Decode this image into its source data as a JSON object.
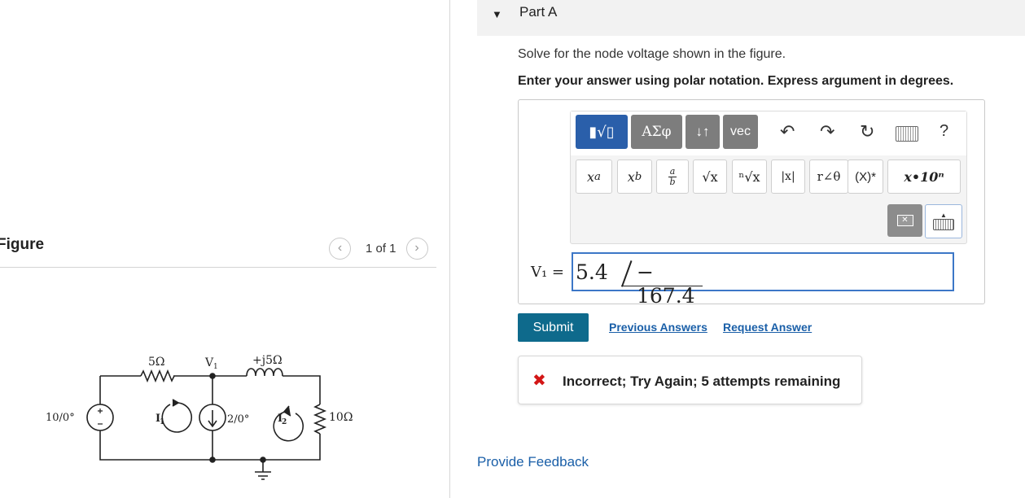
{
  "figure": {
    "title": "Figure",
    "pager_count": "1 of 1",
    "circuit": {
      "source_v": "10/0°",
      "source_i": "2/0°",
      "r1": "5Ω",
      "l1": "+j5Ω",
      "r2": "10Ω",
      "node_v": "V",
      "node_v_sub": "1",
      "mesh1_letter": "I",
      "mesh1_sub": "1",
      "mesh2_letter": "I",
      "mesh2_sub": "2"
    }
  },
  "part": {
    "title": "Part A",
    "question": "Solve for the node voltage shown in the figure.",
    "instruction": "Enter your answer using polar notation. Express argument in degrees."
  },
  "toolbar": {
    "math_label": "▮√▯",
    "greek_label": "ΑΣφ",
    "arrows_label": "↓↑",
    "vec_label": "vec",
    "undo_glyph": "↶",
    "redo_glyph": "↷",
    "reset_glyph": "↻",
    "help_glyph": "?",
    "templates": {
      "superscript_base": "x",
      "superscript_exp": "a",
      "subscript_base": "x",
      "subscript_sub": "b",
      "fraction_num": "a",
      "fraction_den": "b",
      "sqrt": "√x",
      "nth_root": "ⁿ√x",
      "abs": "|x|",
      "polar": "r∠θ",
      "conjugate": "(X)*",
      "sci": "x•10ⁿ"
    }
  },
  "answer": {
    "variable": "V₁ =",
    "magnitude": "5.4",
    "angle": "− 167.4"
  },
  "actions": {
    "submit": "Submit",
    "previous_answers": "Previous Answers",
    "request_answer": "Request Answer"
  },
  "feedback": {
    "icon": "✖",
    "message": "Incorrect; Try Again; 5 attempts remaining"
  },
  "footer": {
    "provide_feedback": "Provide Feedback"
  },
  "colors": {
    "accent_blue": "#2a5faa",
    "submit_teal": "#0e6a8c",
    "error_red": "#d31616",
    "link_blue": "#1a5fa8"
  }
}
